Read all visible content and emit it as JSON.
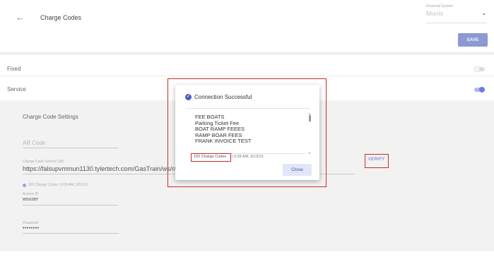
{
  "header": {
    "back_icon": "arrow-left-icon",
    "back_glyph": "←",
    "title": "Charge Codes",
    "financial_system": {
      "label": "Financial System",
      "value": "Munis"
    },
    "save_label": "SAVE"
  },
  "rows": [
    {
      "label": "Fixed",
      "toggle": false
    },
    {
      "label": "Service",
      "toggle": true
    }
  ],
  "settings": {
    "title": "Charge Code Settings",
    "ar_code_placeholder": "AR Code",
    "url_label": "Charge Code Service URL",
    "url_value": "https://falsupvmmun1130.tylertech.com/GasTrain/ws/r/mugws/a",
    "verify_label": "VERIFY",
    "status_text": "192 Charge Codes | 9:28 AM, 3/13/19",
    "access_id_label": "Access ID",
    "access_id_value": "wsuser",
    "password_label": "Password",
    "password_value": "••••••••"
  },
  "modal": {
    "title": "Connection Successful",
    "success_icon": "check-circle-icon",
    "codes": [
      "FEE BOATS",
      "Parking Ticket Fee",
      "BOAT RAMP FEEES",
      "RAMP BOAR FEES",
      "FRANK INVOICE TEST"
    ],
    "count_text": "192 Charge Codes",
    "count_time": "| 9:28 AM, 3/13/19",
    "close_label": "Close"
  },
  "colors": {
    "accent": "#6e7ae0",
    "save_button": "#8c99d2",
    "highlight_border": "#cc2a22"
  }
}
